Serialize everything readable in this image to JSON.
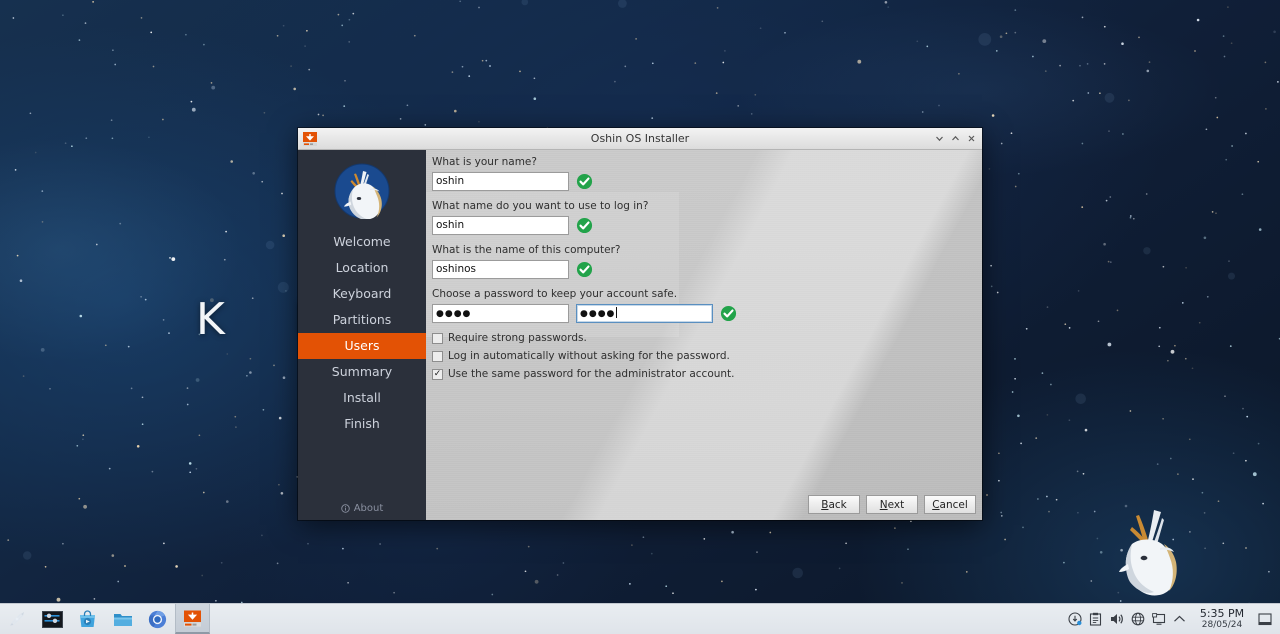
{
  "desktop": {
    "wallpaper_letters": "K  E",
    "wallpaper_logo_icon": "deer-head-logo",
    "sky_color": "#132a47"
  },
  "window": {
    "title": "Oshin OS Installer",
    "icon": "installer-download-icon",
    "controls": {
      "minimize": "minimize-icon",
      "maximize": "maximize-icon",
      "close": "close-icon"
    }
  },
  "sidebar": {
    "logo_icon": "deer-head-logo",
    "accent_color": "#e35205",
    "background_color": "#2b303b",
    "items": [
      {
        "label": "Welcome",
        "active": false
      },
      {
        "label": "Location",
        "active": false
      },
      {
        "label": "Keyboard",
        "active": false
      },
      {
        "label": "Partitions",
        "active": false
      },
      {
        "label": "Users",
        "active": true
      },
      {
        "label": "Summary",
        "active": false
      },
      {
        "label": "Install",
        "active": false
      },
      {
        "label": "Finish",
        "active": false
      }
    ],
    "about_label": "About",
    "about_icon": "info-icon"
  },
  "form": {
    "fields": [
      {
        "label": "What is your name?",
        "value": "oshin",
        "valid_icon": "green-check-icon"
      },
      {
        "label": "What name do you want to use to log in?",
        "value": "oshin",
        "valid_icon": "green-check-icon"
      },
      {
        "label": "What is the name of this computer?",
        "value": "oshinos",
        "valid_icon": "green-check-icon"
      }
    ],
    "password": {
      "label": "Choose a password to keep your account safe.",
      "value_masked": "●●●●",
      "confirm_masked": "●●●●",
      "confirm_focused": true,
      "valid_icon": "green-check-icon"
    },
    "checkboxes": [
      {
        "label": "Require strong passwords.",
        "checked": false
      },
      {
        "label": "Log in automatically without asking for the password.",
        "checked": false
      },
      {
        "label": "Use the same password for the administrator account.",
        "checked": true
      }
    ]
  },
  "footer": {
    "back": {
      "mnemonic": "B",
      "rest": "ack"
    },
    "next": {
      "mnemonic": "N",
      "rest": "ext"
    },
    "cancel": {
      "mnemonic": "C",
      "rest": "ancel"
    }
  },
  "taskbar": {
    "launchers": [
      {
        "icon": "kde-menu-icon",
        "active": false
      },
      {
        "icon": "terminal-icon",
        "active": false
      },
      {
        "icon": "software-store-icon",
        "active": false
      },
      {
        "icon": "file-manager-icon",
        "active": false
      },
      {
        "icon": "chromium-browser-icon",
        "active": false
      },
      {
        "icon": "installer-download-icon",
        "active": true
      }
    ],
    "tray": [
      {
        "icon": "updates-icon"
      },
      {
        "icon": "clipboard-icon"
      },
      {
        "icon": "volume-icon"
      },
      {
        "icon": "network-globe-icon"
      },
      {
        "icon": "display-icon"
      },
      {
        "icon": "chevron-up-icon"
      }
    ],
    "clock": {
      "time": "5:35 PM",
      "date": "28/05/24"
    },
    "show_desktop_icon": "show-desktop-icon"
  }
}
